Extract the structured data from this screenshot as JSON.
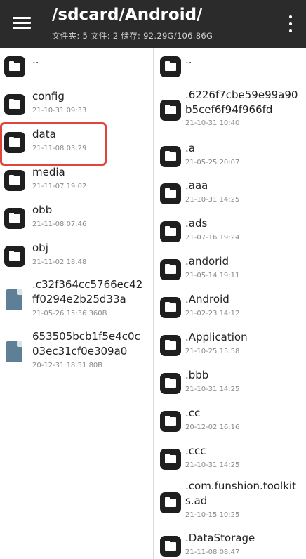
{
  "header": {
    "title": "/sdcard/Android/",
    "subtitle": "文件夹: 5  文件: 2  储存: 92.29G/106.86G"
  },
  "left_pane": [
    {
      "name": "..",
      "meta": "",
      "kind": "folder"
    },
    {
      "name": "config",
      "meta": "21-10-31 09:33",
      "kind": "folder"
    },
    {
      "name": "data",
      "meta": "21-11-08 03:29",
      "kind": "folder"
    },
    {
      "name": "media",
      "meta": "21-11-07 19:02",
      "kind": "folder"
    },
    {
      "name": "obb",
      "meta": "21-11-08 07:46",
      "kind": "folder"
    },
    {
      "name": "obj",
      "meta": "21-11-02 18:48",
      "kind": "folder"
    },
    {
      "name_line1": ".c32f364cc5766ec42",
      "name_line2": "ff0294e2b25d33a",
      "meta": "21-05-26 15:36  360B",
      "kind": "file"
    },
    {
      "name_line1": "653505bcb1f5e4c0c",
      "name_line2": "03ec31cf0e309a0",
      "meta": "20-12-31 18:51  80B",
      "kind": "file"
    }
  ],
  "right_pane": [
    {
      "name": "..",
      "meta": ""
    },
    {
      "name_line1": ".6226f7cbe59e99a90",
      "name_line2": "b5cef6f94f966fd",
      "meta": "21-10-31 10:40"
    },
    {
      "name": ".a",
      "meta": "21-05-25 20:07"
    },
    {
      "name": ".aaa",
      "meta": "21-10-31 14:25"
    },
    {
      "name": ".ads",
      "meta": "21-07-16 19:24"
    },
    {
      "name": ".andorid",
      "meta": "21-05-14 19:11"
    },
    {
      "name": ".Android",
      "meta": "21-02-23 14:12"
    },
    {
      "name": ".Application",
      "meta": "21-10-25 15:58"
    },
    {
      "name": ".bbb",
      "meta": "21-10-31 14:25"
    },
    {
      "name": ".cc",
      "meta": "20-12-02 16:16"
    },
    {
      "name": ".ccc",
      "meta": "21-10-31 14:25"
    },
    {
      "name_line1": ".com.funshion.toolkit",
      "name_line2": "s.ad",
      "meta": "21-10-15 10:25"
    },
    {
      "name": ".DataStorage",
      "meta": "21-11-08 08:47"
    }
  ],
  "colors": {
    "topbar": "#2b2b2b",
    "highlight": "#e0443a",
    "file_icon": "#5f7f96"
  }
}
